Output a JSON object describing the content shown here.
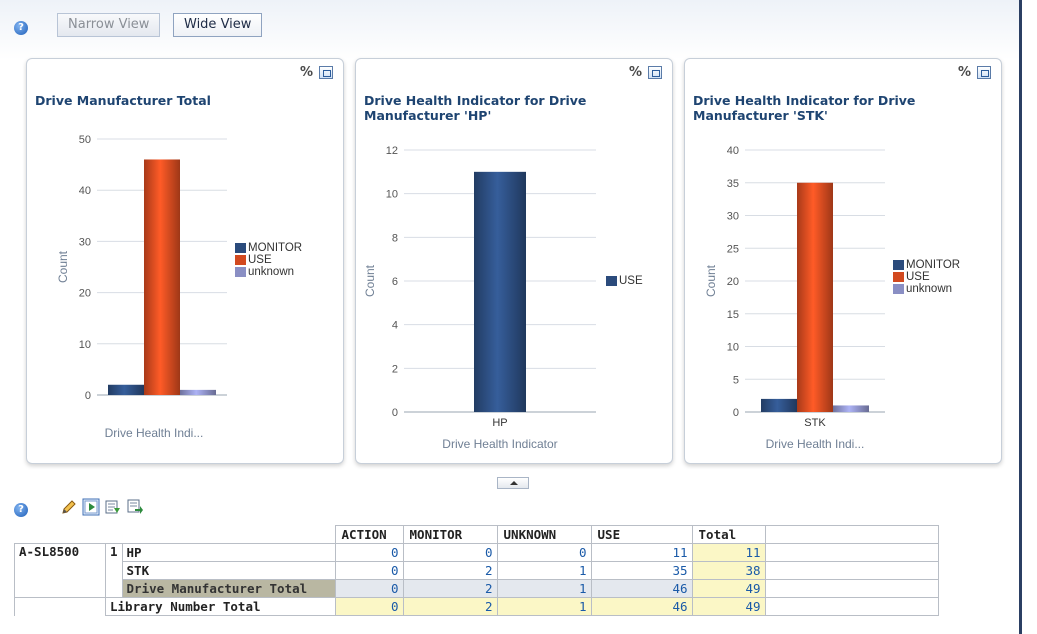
{
  "view_buttons": {
    "narrow": "Narrow View",
    "wide": "Wide View"
  },
  "help_icon_glyph": "?",
  "chart_tools": {
    "percent_glyph": "%"
  },
  "charts": [
    {
      "title": "Drive Manufacturer Total",
      "ylabel": "Count",
      "xlabel": "Drive Health Indi...",
      "ylim": [
        0,
        50
      ],
      "yticks": [
        "0",
        "10",
        "20",
        "30",
        "40",
        "50"
      ],
      "legend": [
        "MONITOR",
        "USE",
        "unknown"
      ]
    },
    {
      "title": "Drive Health Indicator for Drive Manufacturer 'HP'",
      "ylabel": "Count",
      "xlabel": "Drive Health Indicator",
      "ylim": [
        0,
        12
      ],
      "yticks": [
        "0",
        "2",
        "4",
        "6",
        "8",
        "10",
        "12"
      ],
      "category": "HP",
      "legend": [
        "USE"
      ]
    },
    {
      "title": "Drive Health Indicator for Drive Manufacturer 'STK'",
      "ylabel": "Count",
      "xlabel": "Drive Health Indi...",
      "ylim": [
        0,
        40
      ],
      "yticks": [
        "0",
        "5",
        "10",
        "15",
        "20",
        "25",
        "30",
        "35",
        "40"
      ],
      "category": "STK",
      "legend": [
        "MONITOR",
        "USE",
        "unknown"
      ]
    }
  ],
  "chart_data": [
    {
      "type": "bar",
      "title": "Drive Manufacturer Total",
      "xlabel": "Drive Health Indi...",
      "ylabel": "Count",
      "ylim": [
        0,
        50
      ],
      "categories": [
        ""
      ],
      "series": [
        {
          "name": "MONITOR",
          "color": "#2b4b7c",
          "values": [
            2
          ]
        },
        {
          "name": "USE",
          "color": "#d2491f",
          "values": [
            46
          ]
        },
        {
          "name": "unknown",
          "color": "#8a8fc4",
          "values": [
            1
          ]
        }
      ],
      "legend": "right",
      "grid": true
    },
    {
      "type": "bar",
      "title": "Drive Health Indicator for Drive Manufacturer 'HP'",
      "xlabel": "Drive Health Indicator",
      "ylabel": "Count",
      "ylim": [
        0,
        12
      ],
      "categories": [
        "HP"
      ],
      "series": [
        {
          "name": "USE",
          "color": "#2b4b7c",
          "values": [
            11
          ]
        }
      ],
      "legend": "right",
      "grid": true
    },
    {
      "type": "bar",
      "title": "Drive Health Indicator for Drive Manufacturer 'STK'",
      "xlabel": "Drive Health Indi...",
      "ylabel": "Count",
      "ylim": [
        0,
        40
      ],
      "categories": [
        "STK"
      ],
      "series": [
        {
          "name": "MONITOR",
          "color": "#2b4b7c",
          "values": [
            2
          ]
        },
        {
          "name": "USE",
          "color": "#d2491f",
          "values": [
            35
          ]
        },
        {
          "name": "unknown",
          "color": "#8a8fc4",
          "values": [
            1
          ]
        }
      ],
      "legend": "right",
      "grid": true
    }
  ],
  "toolbar_icons": [
    "pencil-icon",
    "play-icon",
    "export-icon",
    "export-alt-icon"
  ],
  "table": {
    "columns": [
      "ACTION",
      "MONITOR",
      "UNKNOWN",
      "USE",
      "Total"
    ],
    "library": "A-SL8500",
    "library_number": "1",
    "rows": [
      {
        "label": "HP",
        "values": [
          "0",
          "0",
          "0",
          "11",
          "11"
        ]
      },
      {
        "label": "STK",
        "values": [
          "0",
          "2",
          "1",
          "35",
          "38"
        ]
      },
      {
        "label": "Drive Manufacturer Total",
        "values": [
          "0",
          "2",
          "1",
          "46",
          "49"
        ]
      },
      {
        "label": "Library Number Total",
        "values": [
          "0",
          "2",
          "1",
          "46",
          "49"
        ]
      }
    ]
  }
}
